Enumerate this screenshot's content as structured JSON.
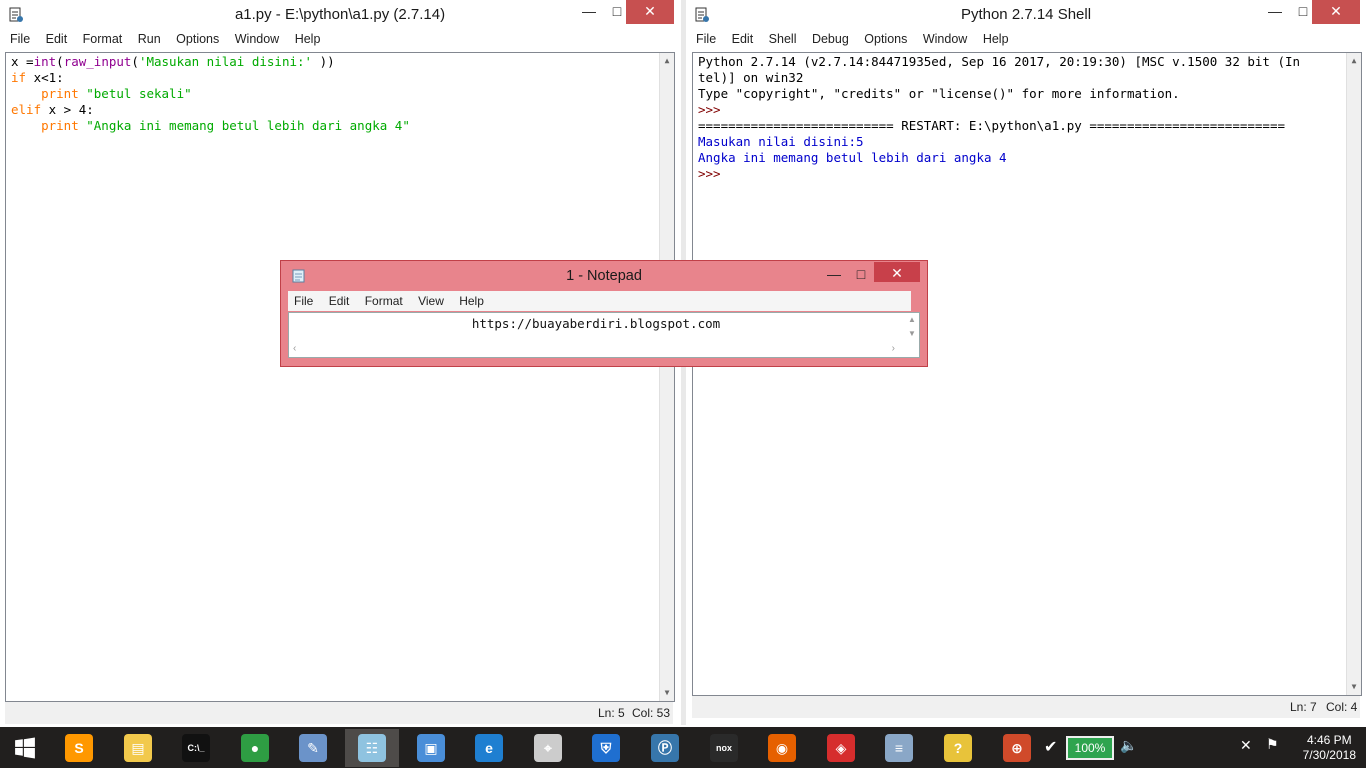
{
  "editor": {
    "title": "a1.py - E:\\python\\a1.py (2.7.14)",
    "menu": [
      "File",
      "Edit",
      "Format",
      "Run",
      "Options",
      "Window",
      "Help"
    ],
    "code": {
      "l1a": "x =",
      "l1b": "int",
      "l1c": "(",
      "l1d": "raw_input",
      "l1e": "(",
      "l1f": "'Masukan nilai disini:'",
      "l1g": " ))",
      "l2a": "if",
      "l2b": " x<1:",
      "l3a": "    print",
      "l3b": " \"betul sekali\"",
      "l4a": "elif",
      "l4b": " x > 4:",
      "l5a": "    print",
      "l5b": " \"Angka ini memang betul lebih dari angka 4\""
    },
    "status": {
      "ln": "Ln: 5",
      "col": "Col: 53"
    }
  },
  "shell": {
    "title": "Python 2.7.14 Shell",
    "menu": [
      "File",
      "Edit",
      "Shell",
      "Debug",
      "Options",
      "Window",
      "Help"
    ],
    "lines": {
      "banner1": "Python 2.7.14 (v2.7.14:84471935ed, Sep 16 2017, 20:19:30) [MSC v.1500 32 bit (In",
      "banner2": "tel)] on win32",
      "banner3": "Type \"copyright\", \"credits\" or \"license()\" for more information.",
      "prompt1": ">>>",
      "restart": "========================== RESTART: E:\\python\\a1.py ==========================",
      "out1": "Masukan nilai disini:5",
      "out2": "Angka ini memang betul lebih dari angka 4",
      "prompt2": ">>>"
    },
    "status": {
      "ln": "Ln: 7",
      "col": "Col: 4"
    }
  },
  "notepad": {
    "title": "1 - Notepad",
    "menu": [
      "File",
      "Edit",
      "Format",
      "View",
      "Help"
    ],
    "content": "https://buayaberdiri.blogspot.com"
  },
  "window_controls": {
    "minimize": "—",
    "maximize": "□",
    "close": "✕"
  },
  "taskbar": {
    "battery": "100%",
    "time": "4:46 PM",
    "date": "7/30/2018",
    "apps": [
      {
        "name": "sublime-text-icon",
        "glyph": "S",
        "color": "#ff9800"
      },
      {
        "name": "file-explorer-icon",
        "glyph": "▤",
        "color": "#f2c94c"
      },
      {
        "name": "cmd-icon",
        "glyph": "C:\\_",
        "color": "#111111"
      },
      {
        "name": "chrome-icon",
        "glyph": "●",
        "color": "#2e9d43"
      },
      {
        "name": "paint-icon",
        "glyph": "✎",
        "color": "#6b93c9"
      },
      {
        "name": "notepad-icon",
        "glyph": "☷",
        "color": "#8fc3e0"
      },
      {
        "name": "remote-desktop-icon",
        "glyph": "▣",
        "color": "#4a8ed8"
      },
      {
        "name": "edge-icon",
        "glyph": "e",
        "color": "#1f7fd1"
      },
      {
        "name": "compass-icon",
        "glyph": "⌖",
        "color": "#cccccc"
      },
      {
        "name": "defender-icon",
        "glyph": "⛨",
        "color": "#1f6fd0"
      },
      {
        "name": "python-icon",
        "glyph": "Ⓟ",
        "color": "#3776ab"
      },
      {
        "name": "nox-icon",
        "glyph": "nox",
        "color": "#2a2a2a"
      },
      {
        "name": "firefox-icon",
        "glyph": "◉",
        "color": "#e66000"
      },
      {
        "name": "garena-icon",
        "glyph": "◈",
        "color": "#d62d2d"
      },
      {
        "name": "task-manager-icon",
        "glyph": "≡",
        "color": "#8aa7c7"
      },
      {
        "name": "help-icon",
        "glyph": "?",
        "color": "#e8c33a"
      },
      {
        "name": "office-icon",
        "glyph": "⊕",
        "color": "#d04a2a"
      }
    ]
  }
}
